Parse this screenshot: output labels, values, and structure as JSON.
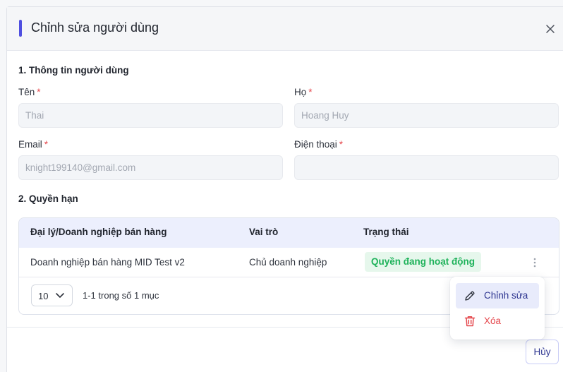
{
  "modal": {
    "title": "Chỉnh sửa người dùng"
  },
  "section1": {
    "title": "1. Thông tin người dùng",
    "first_name": {
      "label": "Tên",
      "required_mark": "*",
      "value": "Thai"
    },
    "last_name": {
      "label": "Họ",
      "required_mark": "*",
      "value": "Hoang Huy"
    },
    "email": {
      "label": "Email",
      "required_mark": "*",
      "value": "knight199140@gmail.com"
    },
    "phone": {
      "label": "Điện thoại",
      "required_mark": "*",
      "value": ""
    }
  },
  "section2": {
    "title": "2. Quyền hạn",
    "table": {
      "headers": [
        "Đại lý/Doanh nghiệp bán hàng",
        "Vai trò",
        "Trạng thái"
      ],
      "rows": [
        {
          "business": "Doanh nghiệp bán hàng MID Test v2",
          "role": "Chủ doanh nghiệp",
          "status": "Quyền đang hoạt động"
        }
      ]
    },
    "pagination": {
      "page_size": "10",
      "info": "1-1 trong số 1 mục"
    }
  },
  "row_menu": {
    "items": [
      {
        "label": "Chỉnh sửa",
        "icon": "pencil-icon"
      },
      {
        "label": "Xóa",
        "icon": "trash-icon"
      }
    ]
  },
  "footer": {
    "cancel_label": "Hủy"
  },
  "colors": {
    "accent": "#4f4fe0",
    "required": "#e5484d",
    "status_text": "#1eb25a",
    "status_bg": "#e6f7ec",
    "table_header_bg": "#eceffd",
    "menu_active_bg": "#e8ebfb",
    "danger": "#e5484d"
  }
}
